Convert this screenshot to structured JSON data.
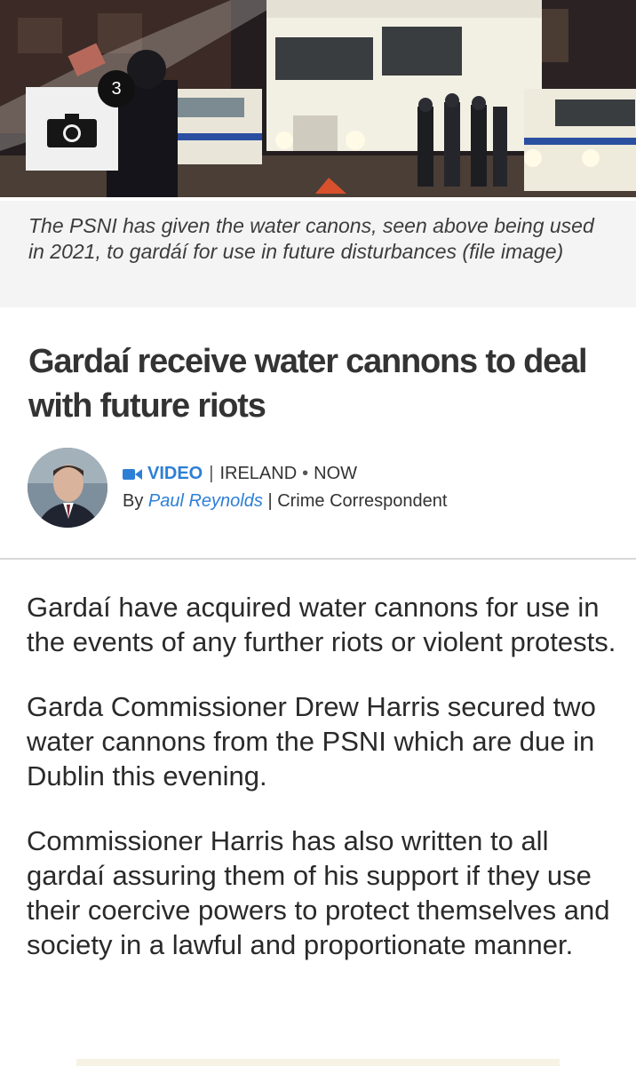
{
  "hero": {
    "gallery_count": "3",
    "camera_icon": "camera-icon"
  },
  "caption": {
    "text": "The PSNI has given the water canons, seen above being used in 2021, to gardáí for use in future disturbances (file image)"
  },
  "headline": "Gardaí receive water cannons to deal with future riots",
  "byline": {
    "video_label": "VIDEO",
    "section": "IRELAND",
    "time": "NOW",
    "by_prefix": "By",
    "author": "Paul Reynolds",
    "role": "Crime Correspondent",
    "video_icon": "video-camera-icon"
  },
  "article": {
    "paragraphs": [
      "Gardaí have acquired water cannons for use in the events of any further riots or violent protests.",
      "Garda Commissioner Drew Harris secured two water cannons from the PSNI which are due in Dublin this evening.",
      "Commissioner Harris has also written to all gardaí assuring them of his support if they use their coercive powers to protect themselves and society in a lawful and proportionate manner."
    ]
  },
  "colors": {
    "link": "#2d7fd6",
    "caption_bg": "#f4f4f4",
    "headline": "#333333"
  }
}
